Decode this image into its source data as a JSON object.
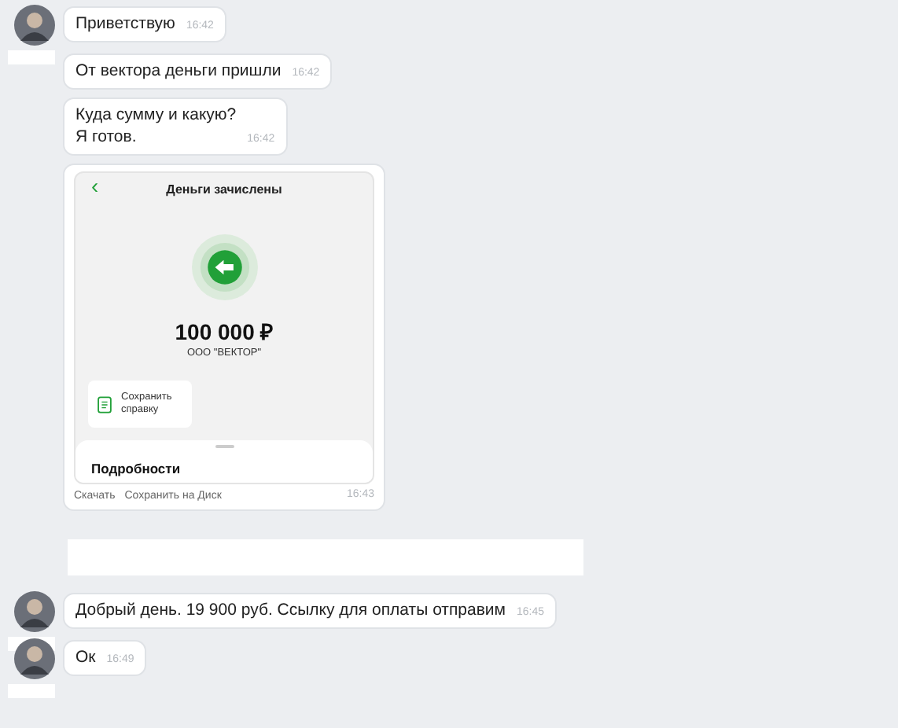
{
  "messages": [
    {
      "kind": "text",
      "avatar": true,
      "name_hidden": true,
      "lines": [
        "Приветствую"
      ],
      "time": "16:42"
    },
    {
      "kind": "text",
      "avatar": false,
      "name_hidden": false,
      "lines": [
        "От вектора деньги пришли"
      ],
      "time": "16:42"
    },
    {
      "kind": "text",
      "avatar": false,
      "name_hidden": false,
      "lines": [
        "Куда сумму и какую?",
        "Я готов."
      ],
      "time": "16:42"
    },
    {
      "kind": "receipt",
      "avatar": false,
      "name_hidden": false,
      "screen_title": "Деньги зачислены",
      "back": "‹",
      "amount": "100 000 ₽",
      "payee": "ООО \"ВЕКТОР\"",
      "save_label": "Сохранить справку",
      "details": "Подробности",
      "actions": [
        "Скачать",
        "Сохранить на Диск"
      ],
      "time": "16:43"
    },
    {
      "kind": "redacted",
      "avatar": false,
      "name_hidden": false
    },
    {
      "kind": "text",
      "avatar": true,
      "name_hidden": true,
      "lines": [
        "Добрый день. 19 900 руб. Ссылку для оплаты отправим"
      ],
      "time": "16:45"
    },
    {
      "kind": "text",
      "avatar": true,
      "name_hidden": true,
      "lines": [
        "Ок"
      ],
      "time": "16:49"
    }
  ]
}
